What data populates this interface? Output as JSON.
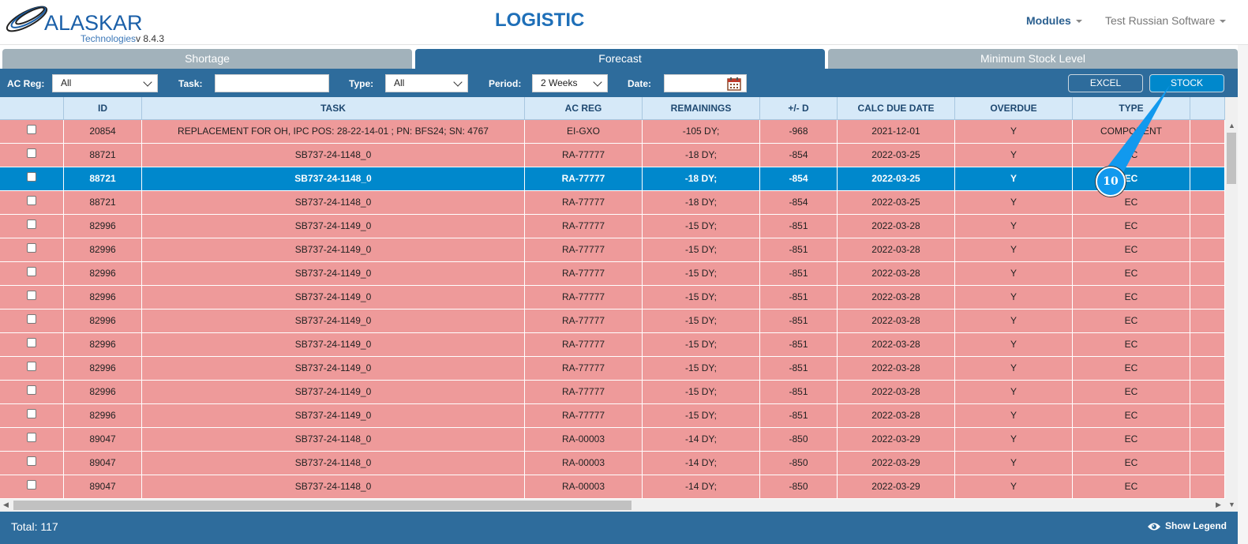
{
  "header": {
    "brand": "ALASKAR",
    "brand_sub": "Technologies",
    "version": "v 8.4.3",
    "title": "LOGISTIC",
    "modules": "Modules",
    "user": "Test Russian Software"
  },
  "tabs": [
    {
      "label": "Shortage"
    },
    {
      "label": "Forecast",
      "active": true
    },
    {
      "label": "Minimum Stock Level"
    }
  ],
  "filters": {
    "ac_reg_label": "AC Reg:",
    "ac_reg_value": "All",
    "task_label": "Task:",
    "task_value": "",
    "type_label": "Type:",
    "type_value": "All",
    "period_label": "Period:",
    "period_value": "2 Weeks",
    "date_label": "Date:",
    "date_value": "",
    "excel": "EXCEL",
    "stock": "STOCK"
  },
  "table": {
    "columns": [
      "",
      "ID",
      "TASK",
      "AC REG",
      "REMAININGS",
      "+/- D",
      "CALC DUE DATE",
      "OVERDUE",
      "TYPE",
      ""
    ],
    "rows": [
      [
        "20854",
        "REPLACEMENT FOR OH, IPC POS: 28-22-14-01 ; PN: BFS24; SN: 4767",
        "EI-GXO",
        "-105 DY;",
        "-968",
        "2021-12-01",
        "Y",
        "COMPONENT"
      ],
      [
        "88721",
        "SB737-24-1148_0",
        "RA-77777",
        "-18 DY;",
        "-854",
        "2022-03-25",
        "Y",
        "EC"
      ],
      [
        "88721",
        "SB737-24-1148_0",
        "RA-77777",
        "-18 DY;",
        "-854",
        "2022-03-25",
        "Y",
        "EC"
      ],
      [
        "88721",
        "SB737-24-1148_0",
        "RA-77777",
        "-18 DY;",
        "-854",
        "2022-03-25",
        "Y",
        "EC"
      ],
      [
        "82996",
        "SB737-24-1149_0",
        "RA-77777",
        "-15 DY;",
        "-851",
        "2022-03-28",
        "Y",
        "EC"
      ],
      [
        "82996",
        "SB737-24-1149_0",
        "RA-77777",
        "-15 DY;",
        "-851",
        "2022-03-28",
        "Y",
        "EC"
      ],
      [
        "82996",
        "SB737-24-1149_0",
        "RA-77777",
        "-15 DY;",
        "-851",
        "2022-03-28",
        "Y",
        "EC"
      ],
      [
        "82996",
        "SB737-24-1149_0",
        "RA-77777",
        "-15 DY;",
        "-851",
        "2022-03-28",
        "Y",
        "EC"
      ],
      [
        "82996",
        "SB737-24-1149_0",
        "RA-77777",
        "-15 DY;",
        "-851",
        "2022-03-28",
        "Y",
        "EC"
      ],
      [
        "82996",
        "SB737-24-1149_0",
        "RA-77777",
        "-15 DY;",
        "-851",
        "2022-03-28",
        "Y",
        "EC"
      ],
      [
        "82996",
        "SB737-24-1149_0",
        "RA-77777",
        "-15 DY;",
        "-851",
        "2022-03-28",
        "Y",
        "EC"
      ],
      [
        "82996",
        "SB737-24-1149_0",
        "RA-77777",
        "-15 DY;",
        "-851",
        "2022-03-28",
        "Y",
        "EC"
      ],
      [
        "82996",
        "SB737-24-1149_0",
        "RA-77777",
        "-15 DY;",
        "-851",
        "2022-03-28",
        "Y",
        "EC"
      ],
      [
        "89047",
        "SB737-24-1148_0",
        "RA-00003",
        "-14 DY;",
        "-850",
        "2022-03-29",
        "Y",
        "EC"
      ],
      [
        "89047",
        "SB737-24-1148_0",
        "RA-00003",
        "-14 DY;",
        "-850",
        "2022-03-29",
        "Y",
        "EC"
      ],
      [
        "89047",
        "SB737-24-1148_0",
        "RA-00003",
        "-14 DY;",
        "-850",
        "2022-03-29",
        "Y",
        "EC"
      ]
    ],
    "selected_row": 2
  },
  "footer": {
    "total": "Total: 117",
    "show_legend": "Show Legend"
  },
  "annotation": {
    "label": "10"
  },
  "colors": {
    "primary": "#2e6c9c",
    "overdue_row": "#ee9a9a",
    "selected_row": "#0088cc",
    "header": "#d6e9f8"
  }
}
